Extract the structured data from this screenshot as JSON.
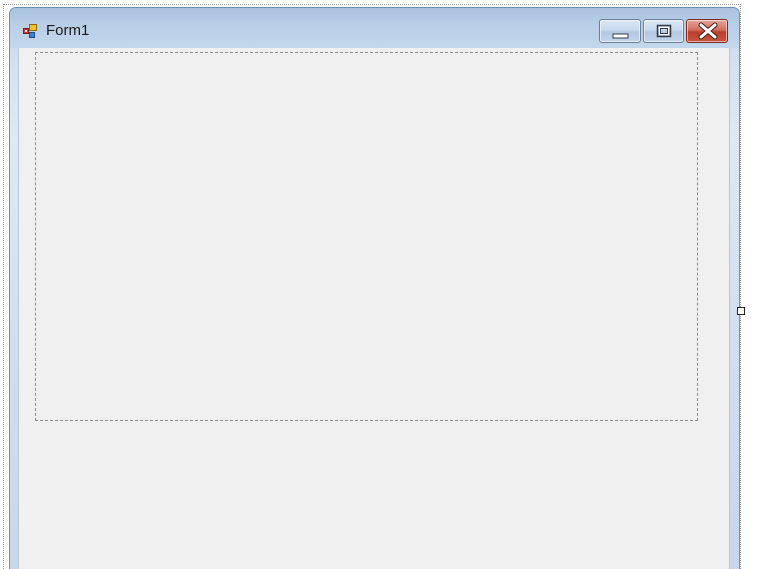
{
  "form": {
    "title": "Form1",
    "icon": "windows-forms-app-icon"
  },
  "caption_buttons": {
    "minimize_icon": "minimize-icon",
    "maximize_icon": "maximize-icon",
    "close_icon": "close-icon",
    "close_color": "#c9553f"
  },
  "colors": {
    "client_background": "#f0f0f0",
    "frame_accent": "#6f8fb3"
  }
}
